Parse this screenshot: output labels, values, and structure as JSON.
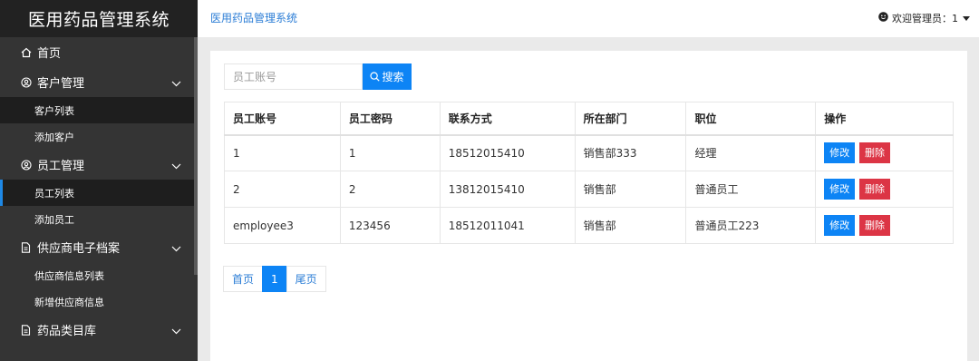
{
  "sidebar": {
    "brand": "医用药品管理系统",
    "home": "首页",
    "groups": [
      {
        "label": "客户管理",
        "items": [
          "客户列表",
          "添加客户"
        ]
      },
      {
        "label": "员工管理",
        "items": [
          "员工列表",
          "添加员工"
        ]
      },
      {
        "label": "供应商电子档案",
        "items": [
          "供应商信息列表",
          "新增供应商信息"
        ]
      },
      {
        "label": "药品类目库",
        "items": []
      }
    ]
  },
  "topbar": {
    "title": "医用药品管理系统",
    "user": "欢迎管理员：1"
  },
  "search": {
    "placeholder": "员工账号",
    "button": "搜索"
  },
  "table": {
    "headers": [
      "员工账号",
      "员工密码",
      "联系方式",
      "所在部门",
      "职位",
      "操作"
    ],
    "rows": [
      [
        "1",
        "1",
        "18512015410",
        "销售部333",
        "经理"
      ],
      [
        "2",
        "2",
        "13812015410",
        "销售部",
        "普通员工"
      ],
      [
        "employee3",
        "123456",
        "18512011041",
        "销售部",
        "普通员工223"
      ]
    ],
    "edit_label": "修改",
    "delete_label": "删除"
  },
  "pager": {
    "first": "首页",
    "current": "1",
    "last": "尾页"
  },
  "colors": {
    "primary": "#0d84f5",
    "danger": "#dc3545",
    "sidebar_bg": "#343434",
    "brand_bg": "#222222",
    "link": "#2b7dd6"
  }
}
